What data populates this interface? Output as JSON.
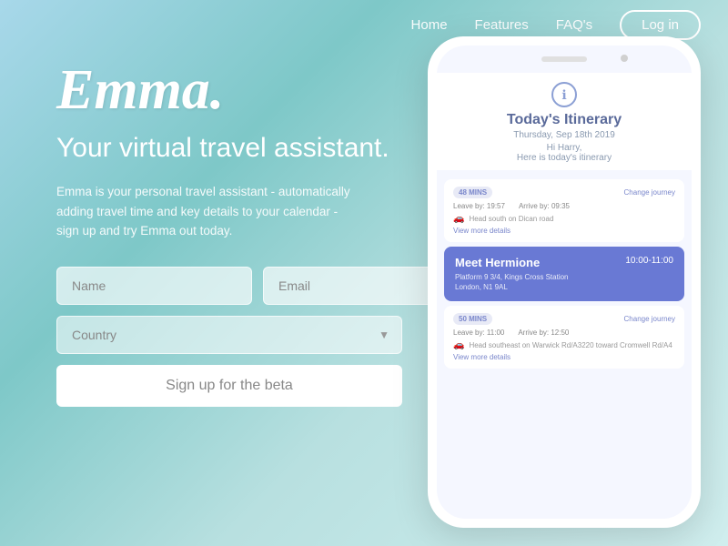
{
  "nav": {
    "home": "Home",
    "features": "Features",
    "faqs": "FAQ's",
    "login": "Log in"
  },
  "hero": {
    "brand": "Emma.",
    "tagline": "Your virtual travel assistant.",
    "description": "Emma is your personal travel assistant - automatically adding travel time and key details to your calendar - sign up and try Emma out today."
  },
  "form": {
    "name_placeholder": "Name",
    "email_placeholder": "Email",
    "country_placeholder": "Country",
    "signup_label": "Sign up for the beta"
  },
  "phone": {
    "icon": "ℹ",
    "screen_title": "Today's Itinerary",
    "screen_date": "Thursday, Sep 18th 2019",
    "greeting_line1": "Hi Harry,",
    "greeting_line2": "Here is today's itinerary",
    "journey1": {
      "badge": "48 MINS",
      "change": "Change journey",
      "leave": "Leave by: 19:57",
      "arrive": "Arrive by: 09:35",
      "desc": "Head south on Dican road",
      "view_more": "View more details"
    },
    "event": {
      "title": "Meet Hermione",
      "time": "10:00-11:00",
      "location_line1": "Platform 9 3/4, Kings Cross Station",
      "location_line2": "London, N1 9AL"
    },
    "journey2": {
      "badge": "50 MINS",
      "change": "Change journey",
      "leave": "Leave by: 11:00",
      "arrive": "Arrive by: 12:50",
      "desc": "Head southeast on Warwick Rd/A3220 toward Cromwell Rd/A4",
      "view_more": "View more details"
    }
  }
}
